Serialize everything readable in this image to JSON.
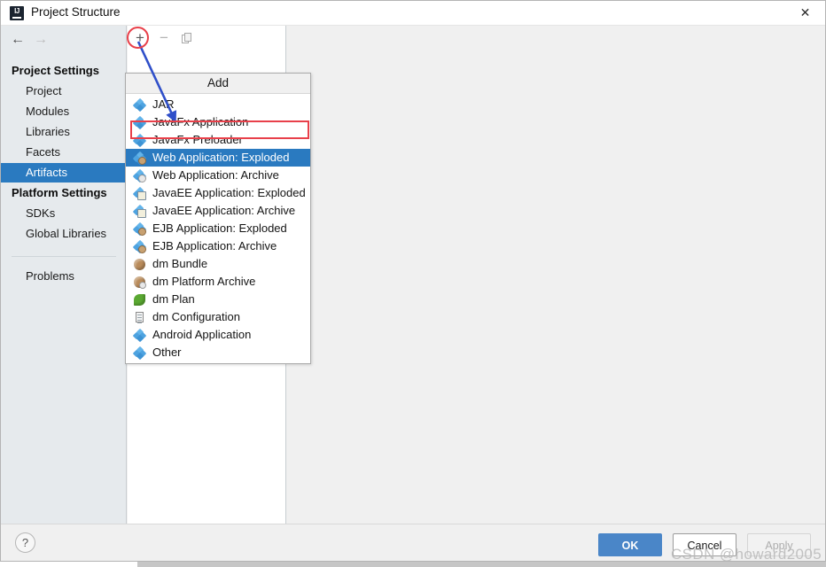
{
  "window": {
    "title": "Project Structure",
    "logo_text": "IJ",
    "close_icon": "✕"
  },
  "nav": {
    "back_icon": "←",
    "forward_icon": "→"
  },
  "sidebar": {
    "groups": [
      {
        "label": "Project Settings"
      },
      {
        "label": "Platform Settings"
      }
    ],
    "project_items": [
      {
        "label": "Project",
        "selected": false
      },
      {
        "label": "Modules",
        "selected": false
      },
      {
        "label": "Libraries",
        "selected": false
      },
      {
        "label": "Facets",
        "selected": false
      },
      {
        "label": "Artifacts",
        "selected": true
      }
    ],
    "platform_items": [
      {
        "label": "SDKs",
        "selected": false
      },
      {
        "label": "Global Libraries",
        "selected": false
      }
    ],
    "problems_item": {
      "label": "Problems",
      "selected": false
    }
  },
  "toolbar": {
    "add_icon": "+",
    "remove_icon": "−",
    "copy_icon": "copy-icon"
  },
  "popup": {
    "header": "Add",
    "items": [
      {
        "label": "JAR",
        "icon": "diamond",
        "selected": false
      },
      {
        "label": "JavaFx Application",
        "icon": "diamond",
        "selected": false
      },
      {
        "label": "JavaFx Preloader",
        "icon": "diamond",
        "selected": false
      },
      {
        "label": "Web Application: Exploded",
        "icon": "diamond-exploded",
        "selected": true
      },
      {
        "label": "Web Application: Archive",
        "icon": "diamond-archive",
        "selected": false
      },
      {
        "label": "JavaEE Application: Exploded",
        "icon": "diamond-ee",
        "selected": false
      },
      {
        "label": "JavaEE Application: Archive",
        "icon": "diamond-ee",
        "selected": false
      },
      {
        "label": "EJB Application: Exploded",
        "icon": "diamond-exploded",
        "selected": false
      },
      {
        "label": "EJB Application: Archive",
        "icon": "diamond-exploded",
        "selected": false
      },
      {
        "label": "dm Bundle",
        "icon": "sphere",
        "selected": false
      },
      {
        "label": "dm Platform Archive",
        "icon": "sphere-archive",
        "selected": false
      },
      {
        "label": "dm Plan",
        "icon": "leaf",
        "selected": false
      },
      {
        "label": "dm Configuration",
        "icon": "document",
        "selected": false
      },
      {
        "label": "Android Application",
        "icon": "diamond",
        "selected": false
      },
      {
        "label": "Other",
        "icon": "diamond",
        "selected": false
      }
    ]
  },
  "footer": {
    "help_label": "?",
    "ok_label": "OK",
    "cancel_label": "Cancel",
    "apply_label": "Apply"
  },
  "watermark": {
    "text": "CSDN @howard2005"
  },
  "colors": {
    "accent_blue": "#2a7ac0",
    "ok_button_blue": "#4a86c8",
    "annotation_red": "#e8404a",
    "annotation_arrow_blue": "#2f4fc9",
    "sidebar_bg": "#e6eaed",
    "panel_bg": "#f0f0f0"
  }
}
